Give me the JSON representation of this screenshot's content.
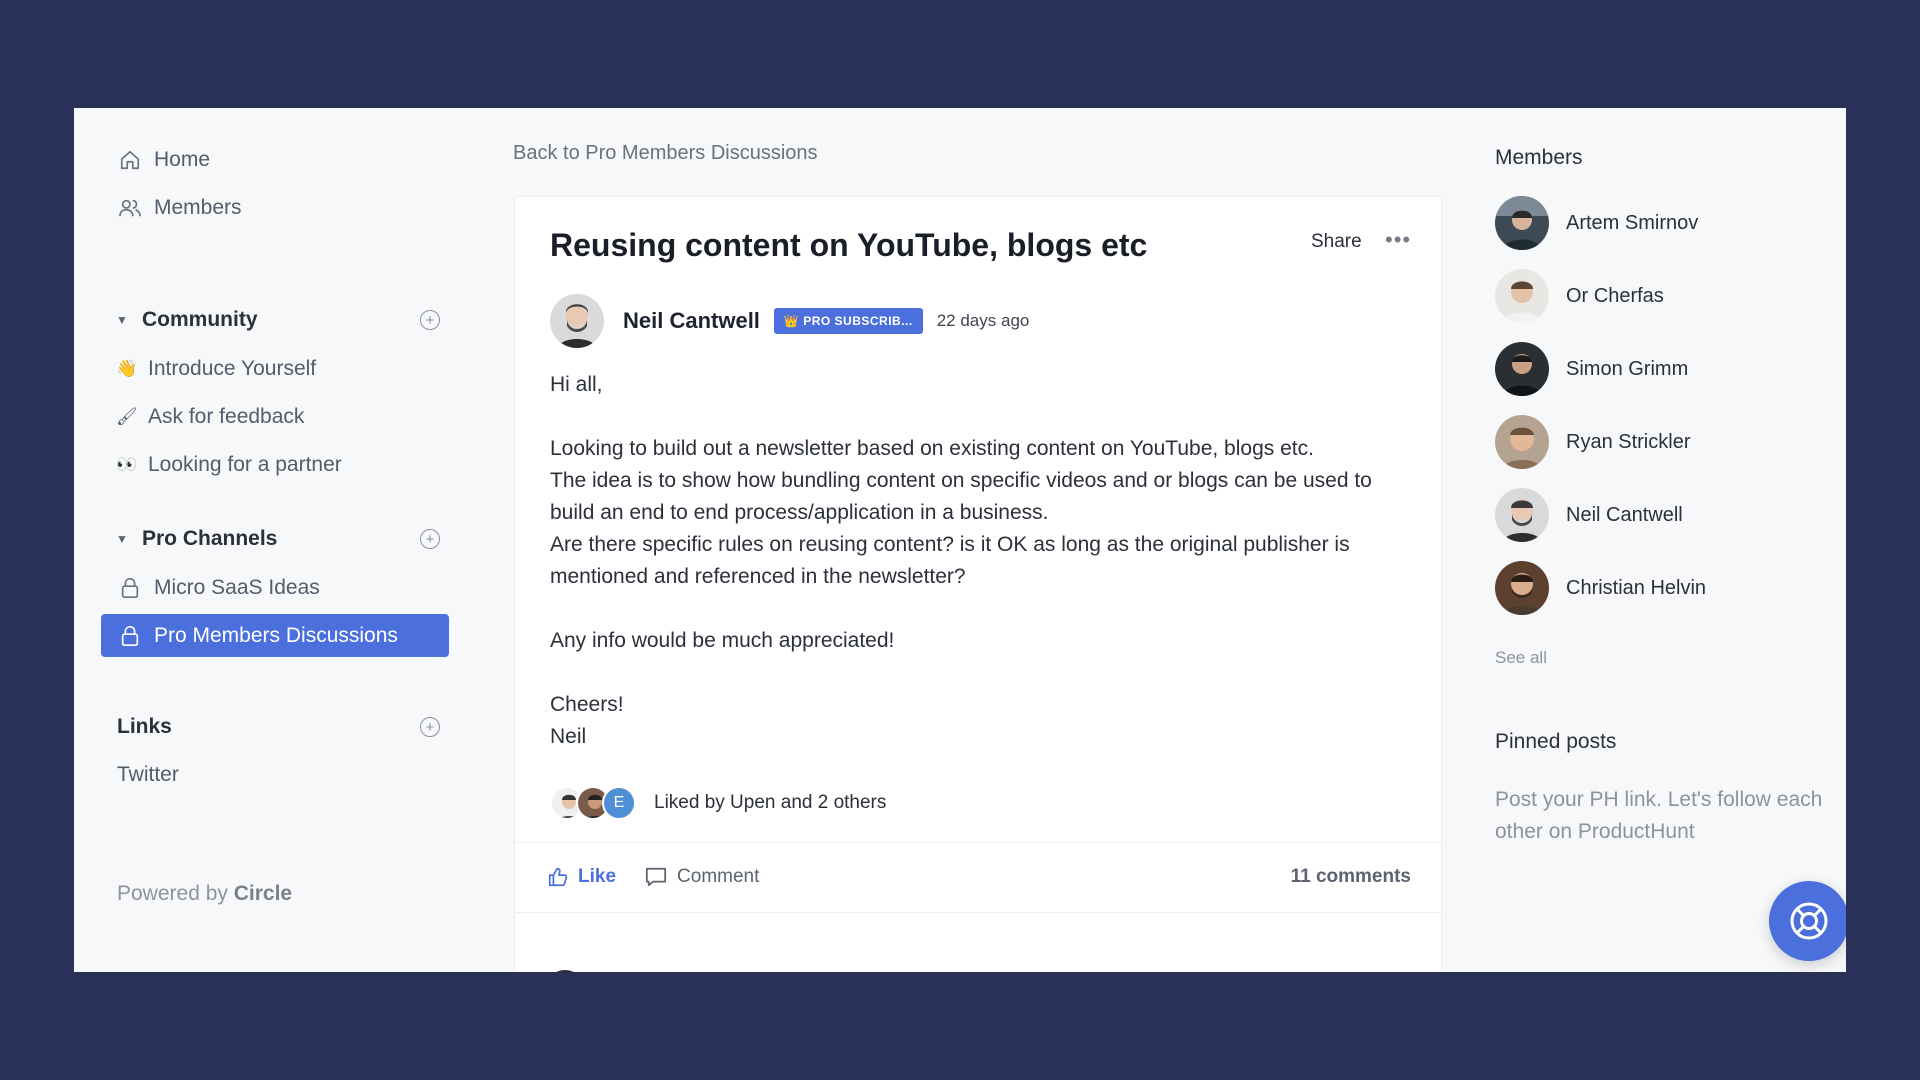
{
  "sidebar": {
    "home": "Home",
    "members": "Members",
    "community": {
      "title": "Community",
      "items": [
        {
          "emoji": "👋",
          "label": "Introduce Yourself"
        },
        {
          "emoji": "🖌",
          "label": "Ask for feedback"
        },
        {
          "emoji": "👀",
          "label": "Looking for a partner"
        }
      ]
    },
    "pro_channels": {
      "title": "Pro Channels",
      "items": [
        {
          "label": "Micro SaaS Ideas"
        },
        {
          "label": "Pro Members Discussions"
        }
      ]
    },
    "links": {
      "title": "Links",
      "items": [
        {
          "label": "Twitter"
        }
      ]
    },
    "powered_prefix": "Powered by",
    "powered_brand": "Circle"
  },
  "main": {
    "back_link": "Back to Pro Members Discussions",
    "post": {
      "title": "Reusing content on YouTube, blogs etc",
      "share": "Share",
      "more": "•••",
      "author": "Neil Cantwell",
      "badge": "PRO SUBSCRIB...",
      "time": "22 days ago",
      "body": {
        "p1": "Hi all,",
        "p2": "Looking to build out a newsletter based on existing content on YouTube, blogs etc.",
        "p3": "The idea is to show how bundling content on specific videos and or blogs can be used to build an end to end process/application in a business.",
        "p4": "Are there specific rules on reusing content? is it OK as long as the original publisher is mentioned and referenced in the newsletter?",
        "p5": "Any info would be much appreciated!",
        "p6": "Cheers!",
        "p7": "Neil"
      },
      "liker_initial": "E",
      "liked_by": "Liked by Upen and 2 others",
      "like": "Like",
      "comment": "Comment",
      "comments_count": "11 comments"
    }
  },
  "right": {
    "members_title": "Members",
    "members": [
      {
        "name": "Artem Smirnov"
      },
      {
        "name": "Or Cherfas"
      },
      {
        "name": "Simon Grimm"
      },
      {
        "name": "Ryan Strickler"
      },
      {
        "name": "Neil Cantwell"
      },
      {
        "name": "Christian Helvin"
      }
    ],
    "see_all": "See all",
    "pinned_title": "Pinned posts",
    "pinned_post": "Post your PH link. Let's follow each other on ProductHunt"
  },
  "colors": {
    "background": "#2a3159",
    "accent": "#4b6fdc",
    "panel": "#f7f8fa"
  }
}
